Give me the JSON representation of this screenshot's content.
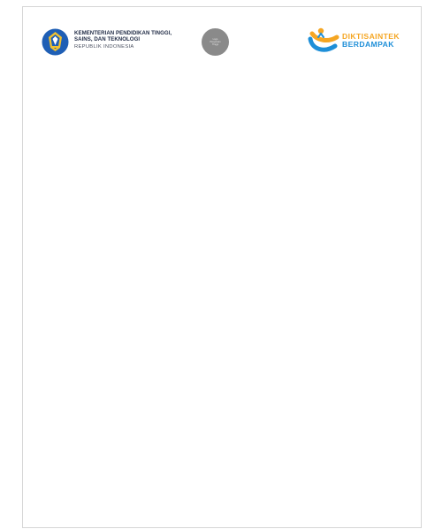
{
  "header": {
    "ministry_line1": "KEMENTERIAN PENDIDIKAN TINGGI,",
    "ministry_line2": "SAINS, DAN TEKNOLOGI",
    "ministry_sub": "REPUBLIK INDONESIA",
    "placeholder_logo": {
      "line1": "Logo",
      "line2": "Perguruan",
      "line3": "Tinggi"
    },
    "brand_top": "DIKTISAINTEK",
    "brand_bottom": "BERDAMPAK",
    "colors": {
      "ministry_blue": "#1f5fb5",
      "placeholder_gray": "#8a8a8a",
      "brand_orange": "#f5a623",
      "brand_blue": "#1e8fd8"
    }
  }
}
